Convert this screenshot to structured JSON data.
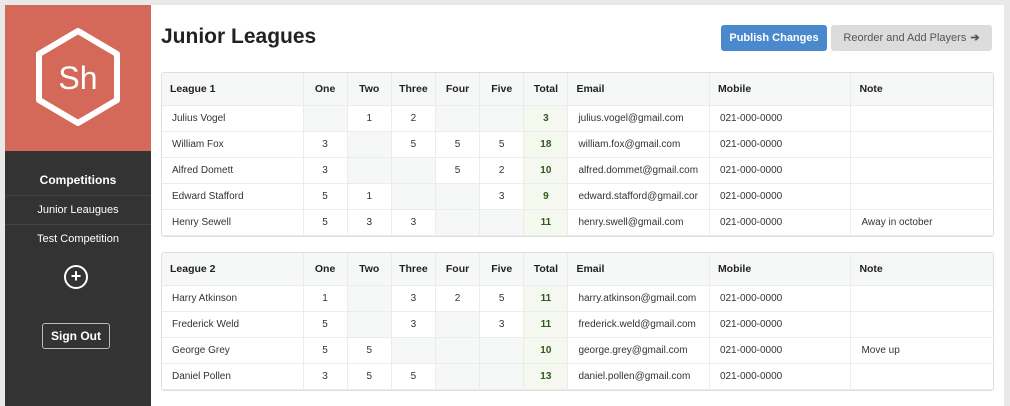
{
  "app": {
    "logo_text": "Sh"
  },
  "sidebar": {
    "items": [
      {
        "label": "Competitions"
      },
      {
        "label": "Junior Leaugues"
      },
      {
        "label": "Test Competition"
      }
    ],
    "add_label": "+",
    "signout_label": "Sign Out"
  },
  "header": {
    "title": "Junior Leagues",
    "publish_label": "Publish Changes",
    "reorder_label": "Reorder and Add Players",
    "reorder_arrow": "➔"
  },
  "columns": [
    "One",
    "Two",
    "Three",
    "Four",
    "Five",
    "Total",
    "Email",
    "Mobile",
    "Note"
  ],
  "leagues": [
    {
      "name": "League 1",
      "rows": [
        {
          "name": "Julius Vogel",
          "scores": [
            "",
            "1",
            "2",
            "",
            ""
          ],
          "total": "3",
          "email": "julius.vogel@gmail.com",
          "mobile": "021-000-0000",
          "note": ""
        },
        {
          "name": "William Fox",
          "scores": [
            "3",
            "",
            "5",
            "5",
            "5"
          ],
          "total": "18",
          "email": "william.fox@gmail.com",
          "mobile": "021-000-0000",
          "note": ""
        },
        {
          "name": "Alfred Domett",
          "scores": [
            "3",
            "",
            "",
            "5",
            "2"
          ],
          "total": "10",
          "email": "alfred.dommet@gmail.com",
          "mobile": "021-000-0000",
          "note": ""
        },
        {
          "name": "Edward Stafford",
          "scores": [
            "5",
            "1",
            "",
            "",
            "3"
          ],
          "total": "9",
          "email": "edward.stafford@gmail.cor",
          "mobile": "021-000-0000",
          "note": ""
        },
        {
          "name": "Henry Sewell",
          "scores": [
            "5",
            "3",
            "3",
            "",
            ""
          ],
          "total": "11",
          "email": "henry.swell@gmail.com",
          "mobile": "021-000-0000",
          "note": "Away in october"
        }
      ]
    },
    {
      "name": "League 2",
      "rows": [
        {
          "name": "Harry Atkinson",
          "scores": [
            "1",
            "",
            "3",
            "2",
            "5"
          ],
          "total": "11",
          "email": "harry.atkinson@gmail.com",
          "mobile": "021-000-0000",
          "note": ""
        },
        {
          "name": "Frederick Weld",
          "scores": [
            "5",
            "",
            "3",
            "",
            "3"
          ],
          "total": "11",
          "email": "frederick.weld@gmail.com",
          "mobile": "021-000-0000",
          "note": ""
        },
        {
          "name": "George Grey",
          "scores": [
            "5",
            "5",
            "",
            "",
            ""
          ],
          "total": "10",
          "email": "george.grey@gmail.com",
          "mobile": "021-000-0000",
          "note": "Move up"
        },
        {
          "name": "Daniel Pollen",
          "scores": [
            "3",
            "5",
            "5",
            "",
            ""
          ],
          "total": "13",
          "email": "daniel.pollen@gmail.com",
          "mobile": "021-000-0000",
          "note": ""
        }
      ]
    }
  ]
}
